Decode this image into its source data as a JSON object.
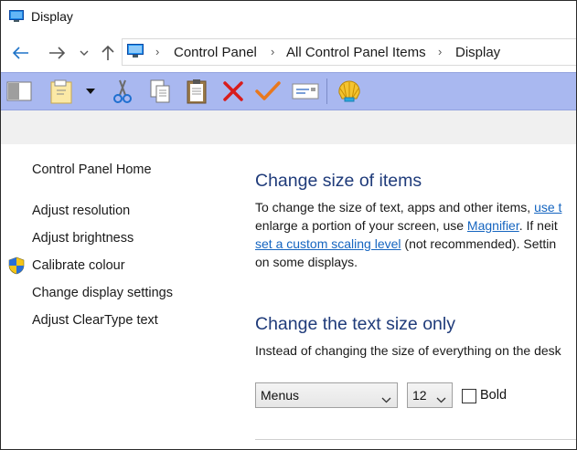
{
  "window": {
    "title": "Display",
    "app_icon": "display-icon"
  },
  "address_bar": {
    "back_icon": "back-arrow-icon",
    "forward_icon": "forward-arrow-icon",
    "recent_icon": "chevron-down-icon",
    "up_icon": "up-arrow-icon",
    "location_icon": "monitor-icon",
    "breadcrumbs": [
      "Control Panel",
      "All Control Panel Items",
      "Display"
    ]
  },
  "toolbar": {
    "buttons": [
      "panel-layout-icon",
      "new-folder-icon",
      "dropdown-arrow-icon",
      "cut-icon",
      "copy-icon",
      "paste-icon",
      "delete-icon",
      "checkmark-icon",
      "rename-icon",
      "shell-icon"
    ],
    "colors": {
      "background": "#a9b8f0",
      "delete": "#d81c1c",
      "check": "#e8781e"
    }
  },
  "sidebar": {
    "home_label": "Control Panel Home",
    "items": [
      {
        "label": "Adjust resolution",
        "icon": ""
      },
      {
        "label": "Adjust brightness",
        "icon": ""
      },
      {
        "label": "Calibrate colour",
        "icon": "uac-shield-icon"
      },
      {
        "label": "Change display settings",
        "icon": ""
      },
      {
        "label": "Adjust ClearType text",
        "icon": ""
      }
    ]
  },
  "main": {
    "size_heading": "Change size of items",
    "size_text": {
      "line1_before": "To change the size of text, apps and other items, ",
      "line1_link": "use t",
      "line2_before": "enlarge a portion of your screen, use ",
      "line2_link": "Magnifier",
      "line2_after": ". If neit",
      "line3_link": "set a custom scaling level",
      "line3_after": " (not recommended). Settin",
      "line4": "on some displays."
    },
    "text_heading": "Change the text size only",
    "text_desc": "Instead of changing the size of everything on the desk",
    "item_select": {
      "value": "Menus"
    },
    "size_select": {
      "value": "12"
    },
    "bold": {
      "label": "Bold",
      "checked": false
    }
  },
  "colors": {
    "heading": "#1f3b7a",
    "link": "#1565c0"
  }
}
